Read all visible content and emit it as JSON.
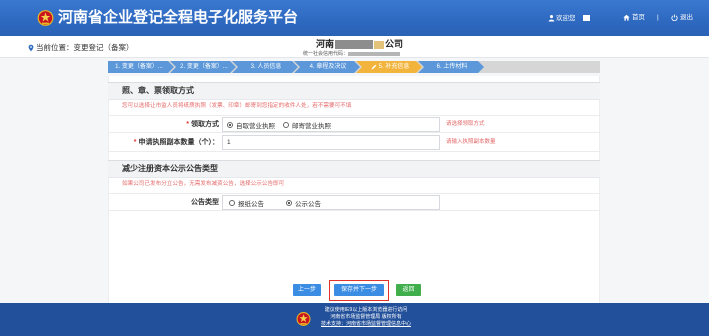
{
  "header": {
    "title": "河南省企业登记全程电子化服务平台",
    "welcome": "欢迎您",
    "home": "首页",
    "separator": "|",
    "logout": "退出"
  },
  "breadcrumb": {
    "label": "当前位置：变更登记（备案）"
  },
  "company": {
    "name_start": "河南",
    "name_end": "公司",
    "code_label": "统一社会信用代码："
  },
  "steps": [
    {
      "label": "1. 变更（备案）..."
    },
    {
      "label": "2. 变更（备案）..."
    },
    {
      "label": "3. 人员信息"
    },
    {
      "label": "4. 章程及决议"
    },
    {
      "label": "5. 补充信息"
    },
    {
      "label": "6. 上传材料"
    }
  ],
  "current_step": 5,
  "pickup_section": {
    "title": "照、章、票领取方式",
    "note": "您可以选择让市监人员将纸质执照（发票、印章）邮寄到您指定的收件人处，若不需要可不填",
    "method": {
      "required_mark": "*",
      "label": "领取方式",
      "options": [
        "自取营业执照",
        "邮寄营业执照"
      ],
      "selected": 0,
      "hint": "请选择领取方式"
    },
    "copies": {
      "required_mark": "*",
      "label": "申请执照副本数量（个）：",
      "value": "1",
      "hint": "请输入执照副本数量"
    }
  },
  "announcement_section": {
    "title": "减少注册资本公示公告类型",
    "note": "如果公司已发布分立公告，无需发布减资公告，选择公示公告即可",
    "type": {
      "label": "公告类型",
      "options": [
        "报纸公告",
        "公示公告"
      ],
      "selected": 1
    }
  },
  "buttons": {
    "prev": "上一步",
    "save_next": "保存并下一步",
    "back": "返回"
  },
  "footer": {
    "lines": [
      "建议使用IE9以上版本浏览器进行访问",
      "河南省市场监督管理局 版权所有",
      "技术支持：河南省市场监督管理信息中心"
    ]
  },
  "icons": {
    "emblem": "national-emblem-icon",
    "user": "user-icon",
    "home": "home-icon",
    "logout": "power-icon",
    "location": "location-pin-icon",
    "current_step": "pencil-icon"
  },
  "colors": {
    "header_blue": "#2e69c0",
    "step_blue": "#5b97d9",
    "step_current": "#f2b43c",
    "hint_red": "#e46a6a",
    "button_blue": "#3b8de3",
    "button_green": "#3fae4b",
    "footer_blue": "#23509a",
    "highlight_red": "#e0322b",
    "required_red": "#e53935"
  }
}
